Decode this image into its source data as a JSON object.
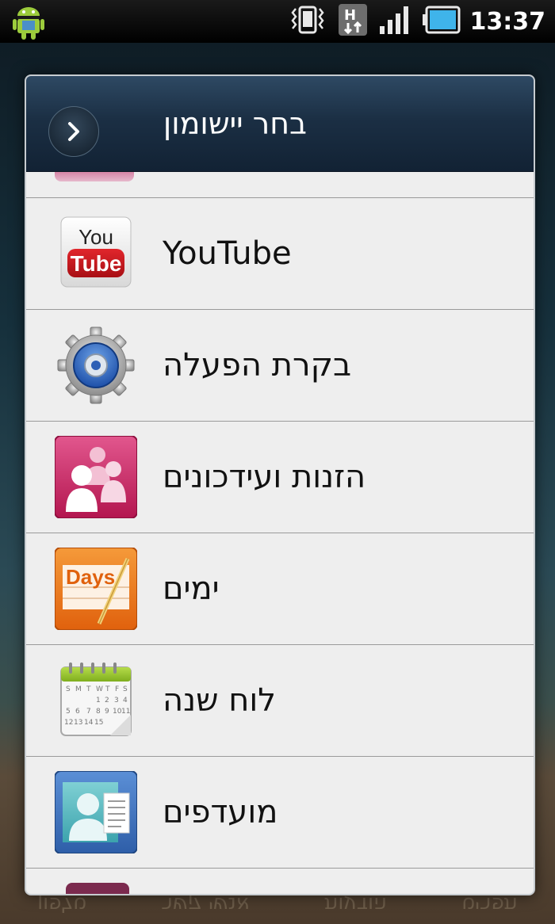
{
  "status_bar": {
    "time": "13:37",
    "icons": [
      "android-notification-icon",
      "vibrate-icon",
      "hsdpa-data-icon",
      "signal-icon",
      "battery-icon"
    ]
  },
  "dialog": {
    "title": "בחר יישומון",
    "items": [
      {
        "label": "YouTube",
        "icon": "youtube-icon"
      },
      {
        "label": "בקרת הפעלה",
        "icon": "power-control-gear-icon"
      },
      {
        "label": "הזנות ועידכונים",
        "icon": "feeds-updates-icon"
      },
      {
        "label": "ימים",
        "icon": "days-icon"
      },
      {
        "label": "לוח שנה",
        "icon": "calendar-icon"
      },
      {
        "label": "מועדפים",
        "icon": "favorites-contact-icon"
      }
    ]
  },
  "background_dock": [
    "טלפון",
    "אנשי קשר",
    "הודעות",
    "תפריט"
  ],
  "colors": {
    "header": "#1b2f44",
    "list_bg": "#eeeeee",
    "divider": "#9a9a9a",
    "youtube_red": "#c4151c",
    "battery_blue": "#3fb4ea"
  }
}
